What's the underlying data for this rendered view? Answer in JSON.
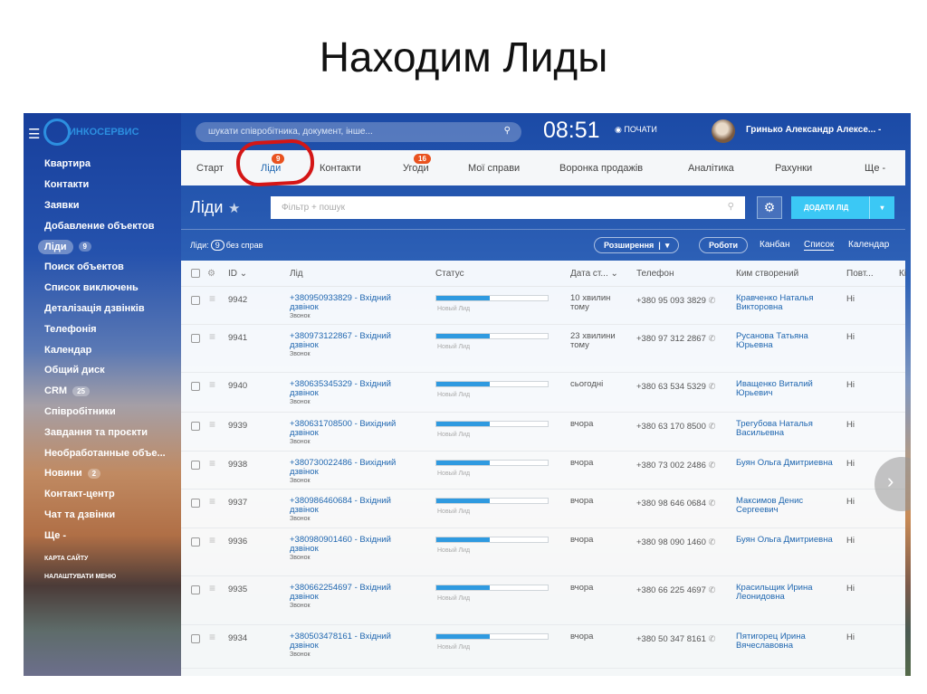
{
  "slide_title": "Находим Лиды",
  "sidebar": {
    "brand": "ИНКОСЕРВИС",
    "items": [
      {
        "label": "Квартира"
      },
      {
        "label": "Контакти"
      },
      {
        "label": "Заявки"
      },
      {
        "label": "Добавление объектов"
      },
      {
        "label": "Ліди",
        "count": "9",
        "active": true
      },
      {
        "label": "Поиск объектов"
      },
      {
        "label": "Список виключень"
      },
      {
        "label": "Деталізація дзвінків"
      },
      {
        "label": "Телефонія"
      },
      {
        "label": "Календар"
      },
      {
        "label": "Общий диск"
      },
      {
        "label": "CRM",
        "count": "25"
      },
      {
        "label": "Співробітники"
      },
      {
        "label": "Завдання та проєкти"
      },
      {
        "label": "Необработанные объе..."
      },
      {
        "label": "Новини",
        "count": "2"
      },
      {
        "label": "Контакт-центр"
      },
      {
        "label": "Чат та дзвінки"
      },
      {
        "label": "Ще -"
      }
    ],
    "site_map": "КАРТА САЙТУ",
    "configure_menu": "НАЛАШТУВАТИ МЕНЮ"
  },
  "header": {
    "search_placeholder": "шукати співробітника, документ, інше...",
    "time": "08:51",
    "start_label": "ПОЧАТИ",
    "user": "Гринько Александр Алексе... -"
  },
  "tabs": [
    {
      "label": "Старт"
    },
    {
      "label": "Ліди",
      "badge": "9"
    },
    {
      "label": "Контакти"
    },
    {
      "label": "Угоди",
      "badge": "16"
    },
    {
      "label": "Мої справи"
    },
    {
      "label": "Воронка продажів"
    },
    {
      "label": "Аналітика"
    },
    {
      "label": "Рахунки"
    },
    {
      "label": "Ще -"
    }
  ],
  "page": {
    "title": "Ліди",
    "filter_placeholder": "Фільтр + пошук",
    "add_button": "ДОДАТИ ЛІД",
    "count_label": "Ліди:",
    "count": "9",
    "count_suffix": "без справ",
    "extensions": "Розширення",
    "robots": "Роботи",
    "views": [
      "Канбан",
      "Список",
      "Календар"
    ]
  },
  "columns": [
    "ID",
    "Лід",
    "Статус",
    "Дата ст...",
    "Телефон",
    "Ким створений",
    "Повт...",
    "Кі"
  ],
  "rows": [
    {
      "id": "9942",
      "lead": "+380950933829 - Вхідний дзвінок",
      "source": "Звонок",
      "status": "Новый Лид",
      "progress": 0.48,
      "date": "10 хвилин тому",
      "phone": "+380 95 093 3829",
      "creator": "Кравченко Наталья Викторовна",
      "repeat": "Ні"
    },
    {
      "id": "9941",
      "lead": "+380973122867 - Вхідний дзвінок",
      "source": "Звонок",
      "status": "Новый Лид",
      "progress": 0.48,
      "date": "23 хвилини тому",
      "phone": "+380 97 312 2867",
      "creator": "Русанова Татьяна Юрьевна",
      "repeat": "Ні"
    },
    {
      "id": "9940",
      "lead": "+380635345329 - Вхідний дзвінок",
      "source": "Звонок",
      "status": "Новый Лид",
      "progress": 0.48,
      "date": "сьогодні",
      "phone": "+380 63 534 5329",
      "creator": "Иващенко Виталий Юрьевич",
      "repeat": "Ні"
    },
    {
      "id": "9939",
      "lead": "+380631708500 - Вихідний дзвінок",
      "source": "Звонок",
      "status": "Новый Лид",
      "progress": 0.48,
      "date": "вчора",
      "phone": "+380 63 170 8500",
      "creator": "Трегубова Наталья Васильевна",
      "repeat": "Ні"
    },
    {
      "id": "9938",
      "lead": "+380730022486 - Вихідний дзвінок",
      "source": "Звонок",
      "status": "Новый Лид",
      "progress": 0.48,
      "date": "вчора",
      "phone": "+380 73 002 2486",
      "creator": "Буян Ольга Дмитриевна",
      "repeat": "Ні"
    },
    {
      "id": "9937",
      "lead": "+380986460684 - Вхідний дзвінок",
      "source": "Звонок",
      "status": "Новый Лид",
      "progress": 0.48,
      "date": "вчора",
      "phone": "+380 98 646 0684",
      "creator": "Максимов Денис Сергеевич",
      "repeat": "Ні"
    },
    {
      "id": "9936",
      "lead": "+380980901460 - Вхідний дзвінок",
      "source": "Звонок",
      "status": "Новый Лид",
      "progress": 0.48,
      "date": "вчора",
      "phone": "+380 98 090 1460",
      "creator": "Буян Ольга Дмитриевна",
      "repeat": "Ні"
    },
    {
      "id": "9935",
      "lead": "+380662254697 - Вхідний дзвінок",
      "source": "Звонок",
      "status": "Новый Лид",
      "progress": 0.48,
      "date": "вчора",
      "phone": "+380 66 225 4697",
      "creator": "Красильщик Ирина Леонидовна",
      "repeat": "Ні"
    },
    {
      "id": "9934",
      "lead": "+380503478161 - Вхідний дзвінок",
      "source": "Звонок",
      "status": "Новый Лид",
      "progress": 0.48,
      "date": "вчора",
      "phone": "+380 50 347 8161",
      "creator": "Пятигорец Ирина Вячеславовна",
      "repeat": "Ні"
    }
  ]
}
